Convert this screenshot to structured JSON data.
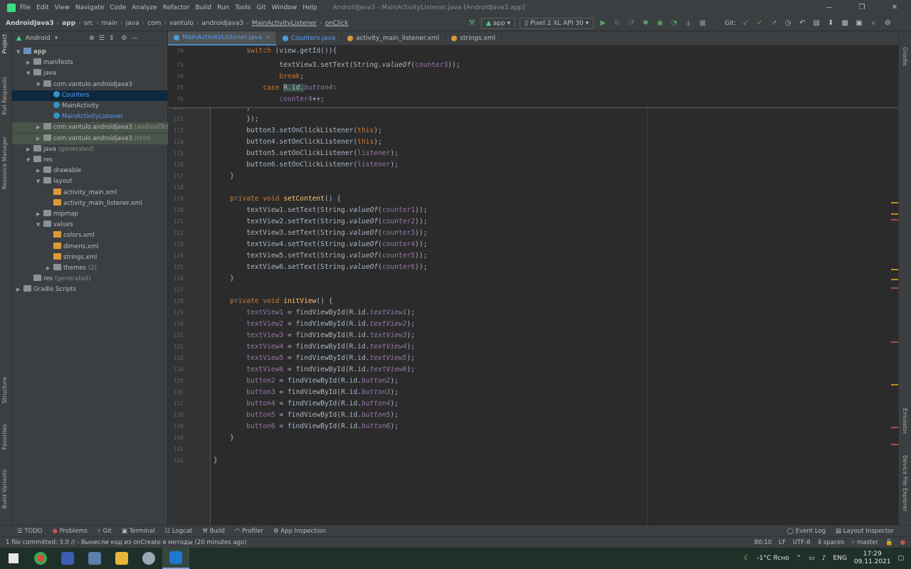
{
  "window": {
    "menu": [
      "File",
      "Edit",
      "View",
      "Navigate",
      "Code",
      "Analyze",
      "Refactor",
      "Build",
      "Run",
      "Tools",
      "Git",
      "Window",
      "Help"
    ],
    "title": "AndroidJava3 - MainActivityListener.java [AndroidJava3.app]",
    "controls": [
      "—",
      "❐",
      "✕"
    ]
  },
  "breadcrumb": [
    "AndroidJava3",
    "app",
    "src",
    "main",
    "java",
    "com",
    "vantulo",
    "androidjava3",
    "MainActivityListener",
    "onClick"
  ],
  "toolbar": {
    "module": "app",
    "device": "Pixel 2 XL API 30",
    "git_label": "Git:"
  },
  "project_panel": {
    "view": "Android"
  },
  "tree": [
    {
      "label": "app",
      "depth": 0,
      "icon": "mod",
      "open": true,
      "bold": true
    },
    {
      "label": "manifests",
      "depth": 1,
      "icon": "folder",
      "open": false
    },
    {
      "label": "java",
      "depth": 1,
      "icon": "folder",
      "open": true
    },
    {
      "label": "com.vantulo.androidjava3",
      "depth": 2,
      "icon": "pkg",
      "open": true
    },
    {
      "label": "Counters",
      "depth": 3,
      "icon": "cls",
      "sel": true,
      "color": "blue"
    },
    {
      "label": "MainActivity",
      "depth": 3,
      "icon": "cls"
    },
    {
      "label": "MainActivityListener",
      "depth": 3,
      "icon": "cls",
      "color": "blue"
    },
    {
      "label": "com.vantulo.androidjava3",
      "suffix": "(androidTest)",
      "depth": 2,
      "icon": "pkg",
      "open": false,
      "mod": true
    },
    {
      "label": "com.vantulo.androidjava3",
      "suffix": "(test)",
      "depth": 2,
      "icon": "pkg",
      "open": false,
      "mod": true
    },
    {
      "label": "java",
      "suffix": "(generated)",
      "depth": 1,
      "icon": "folder",
      "open": false
    },
    {
      "label": "res",
      "depth": 1,
      "icon": "folder",
      "open": true
    },
    {
      "label": "drawable",
      "depth": 2,
      "icon": "folder",
      "open": false
    },
    {
      "label": "layout",
      "depth": 2,
      "icon": "folder",
      "open": true
    },
    {
      "label": "activity_main.xml",
      "depth": 3,
      "icon": "xml"
    },
    {
      "label": "activity_main_listener.xml",
      "depth": 3,
      "icon": "xml"
    },
    {
      "label": "mipmap",
      "depth": 2,
      "icon": "folder",
      "open": false
    },
    {
      "label": "values",
      "depth": 2,
      "icon": "folder",
      "open": true
    },
    {
      "label": "colors.xml",
      "depth": 3,
      "icon": "xml"
    },
    {
      "label": "dimens.xml",
      "depth": 3,
      "icon": "xml"
    },
    {
      "label": "strings.xml",
      "depth": 3,
      "icon": "xml"
    },
    {
      "label": "themes",
      "suffix": "(2)",
      "depth": 3,
      "icon": "folder",
      "open": false
    },
    {
      "label": "res",
      "suffix": "(generated)",
      "depth": 1,
      "icon": "folder",
      "open": false,
      "noarrow": true
    },
    {
      "label": "Gradle Scripts",
      "depth": 0,
      "icon": "folder",
      "open": false
    }
  ],
  "tabs": [
    {
      "label": "MainActivityListener.java",
      "active": true,
      "color": "#4a9fd5"
    },
    {
      "label": "Counters.java",
      "color": "#4a9fd5"
    },
    {
      "label": "activity_main_listener.xml",
      "color": "#d89a3b"
    },
    {
      "label": "strings.xml",
      "color": "#d89a3b"
    }
  ],
  "sticky": [
    {
      "n": "70",
      "html": "        <span class='kw'>switch</span> (view.getId()){"
    },
    {
      "n": "73",
      "html": "                textView3.setText(String.<i>valueOf</i>(<span class='fld'>counter3</span>));"
    },
    {
      "n": "74",
      "html": "                <span class='kw'>break</span>;"
    },
    {
      "n": "75",
      "html": "            <span class='kw'>case</span> R.id.<span class='it'>button4</span>:"
    },
    {
      "n": "76",
      "html": "                <span class='fld'>counter4</span>++;"
    }
  ],
  "code": [
    {
      "n": "111",
      "html": "        }"
    },
    {
      "n": "112",
      "html": "        });"
    },
    {
      "n": "113",
      "html": "        button3.setOnClickListener(<span class='kw'>this</span>);"
    },
    {
      "n": "114",
      "html": "        button4.setOnClickListener(<span class='kw'>this</span>);"
    },
    {
      "n": "115",
      "html": "        button5.setOnClickListener(<span class='fld'>listener</span>);"
    },
    {
      "n": "116",
      "html": "        button6.setOnClickListener(<span class='fld'>listener</span>);"
    },
    {
      "n": "117",
      "html": "    }"
    },
    {
      "n": "118",
      "html": ""
    },
    {
      "n": "119",
      "html": "    <span class='kw'>private void</span> <span class='fn'>setContent</span>() {"
    },
    {
      "n": "120",
      "html": "        textView1.setText(String.<i>valueOf</i>(<span class='fld'>counter1</span>));"
    },
    {
      "n": "121",
      "html": "        textView2.setText(String.<i>valueOf</i>(<span class='fld'>counter2</span>));"
    },
    {
      "n": "122",
      "html": "        textView3.setText(String.<i>valueOf</i>(<span class='fld'>counter3</span>));"
    },
    {
      "n": "123",
      "html": "        textView4.setText(String.<i>valueOf</i>(<span class='fld'>counter4</span>));"
    },
    {
      "n": "124",
      "html": "        textView5.setText(String.<i>valueOf</i>(<span class='fld'>counter5</span>));"
    },
    {
      "n": "125",
      "html": "        textView6.setText(String.<i>valueOf</i>(<span class='fld'>counter6</span>));"
    },
    {
      "n": "126",
      "html": "    }"
    },
    {
      "n": "127",
      "html": ""
    },
    {
      "n": "128",
      "html": "    <span class='kw'>private void</span> <span class='fn'>initView</span>() {"
    },
    {
      "n": "129",
      "html": "        <span class='fld'>textView1</span> = findViewById(R.id.<span class='it'>textView1</span>);"
    },
    {
      "n": "130",
      "html": "        <span class='fld'>textView2</span> = findViewById(R.id.<span class='it'>textView2</span>);"
    },
    {
      "n": "131",
      "html": "        <span class='fld'>textView3</span> = findViewById(R.id.<span class='it'>textView3</span>);"
    },
    {
      "n": "132",
      "html": "        <span class='fld'>textView4</span> = findViewById(R.id.<span class='it'>textView4</span>);"
    },
    {
      "n": "133",
      "html": "        <span class='fld'>textView5</span> = findViewById(R.id.<span class='it'>textView5</span>);"
    },
    {
      "n": "134",
      "html": "        <span class='fld'>textView6</span> = findViewById(R.id.<span class='it'>textView6</span>);"
    },
    {
      "n": "135",
      "html": "        <span class='fld'>button2</span> = findViewById(R.id.<span class='it'>button2</span>);"
    },
    {
      "n": "136",
      "html": "        <span class='fld'>button3</span> = findViewById(R.id.<span class='it'>button3</span>);"
    },
    {
      "n": "137",
      "html": "        <span class='fld'>button4</span> = findViewById(R.id.<span class='it'>button4</span>);"
    },
    {
      "n": "138",
      "html": "        <span class='fld'>button5</span> = findViewById(R.id.<span class='it'>button5</span>);"
    },
    {
      "n": "139",
      "html": "        <span class='fld'>button6</span> = findViewById(R.id.<span class='it'>button6</span>);"
    },
    {
      "n": "140",
      "html": "    }"
    },
    {
      "n": "141",
      "html": ""
    },
    {
      "n": "142",
      "html": "}"
    }
  ],
  "left_tool_tabs": [
    "Project",
    "Pull Requests",
    "Resource Manager",
    "Structure",
    "Favorites",
    "Build Variants"
  ],
  "right_tool_tabs": [
    "Gradle",
    "Emulator",
    "Device File Explorer"
  ],
  "bottom_tools": [
    "TODO",
    "Problems",
    "Git",
    "Terminal",
    "Logcat",
    "Build",
    "Profiler",
    "App Inspection"
  ],
  "bottom_tools_right": [
    "Event Log",
    "Layout Inspector"
  ],
  "status": {
    "message": "1 file committed: 3.0 // - Вынесли код из onCreate в методы (20 minutes ago)",
    "position": "80:10",
    "line_sep": "LF",
    "encoding": "UTF-8",
    "indent": "4 spaces",
    "branch": "master"
  },
  "taskbar": {
    "weather": "-1°C Ясно",
    "lang": "ENG",
    "time": "17:29",
    "date": "09.11.2021"
  }
}
